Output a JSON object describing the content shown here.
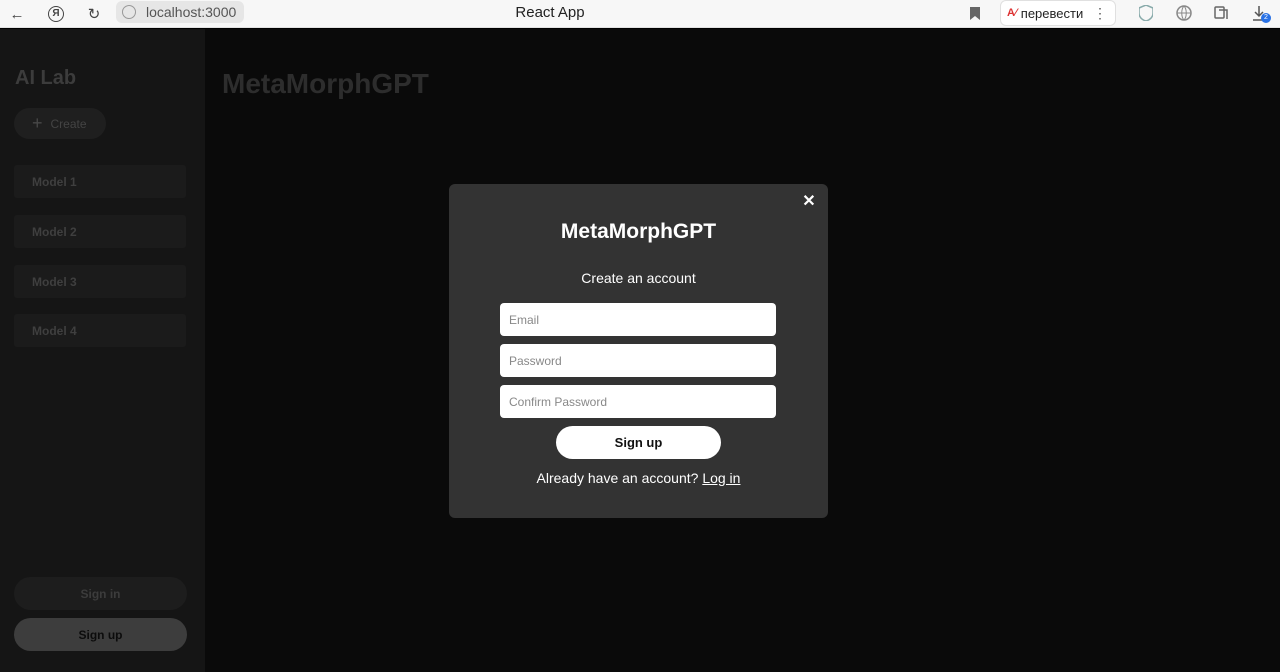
{
  "browser": {
    "url": "localhost:3000",
    "tab_title": "React App",
    "translate_label": "перевести",
    "downloads_badge": "2"
  },
  "sidebar": {
    "brand": "AI Lab",
    "create_label": "Create",
    "models": [
      "Model 1",
      "Model 2",
      "Model 3",
      "Model 4"
    ],
    "signin_label": "Sign in",
    "signup_label": "Sign up"
  },
  "main": {
    "title": "MetaMorphGPT"
  },
  "modal": {
    "close_glyph": "✕",
    "title": "MetaMorphGPT",
    "subtitle": "Create an account",
    "email_placeholder": "Email",
    "password_placeholder": "Password",
    "confirm_placeholder": "Confirm Password",
    "submit_label": "Sign up",
    "login_prompt": "Already have an account?",
    "login_link": "Log in"
  }
}
